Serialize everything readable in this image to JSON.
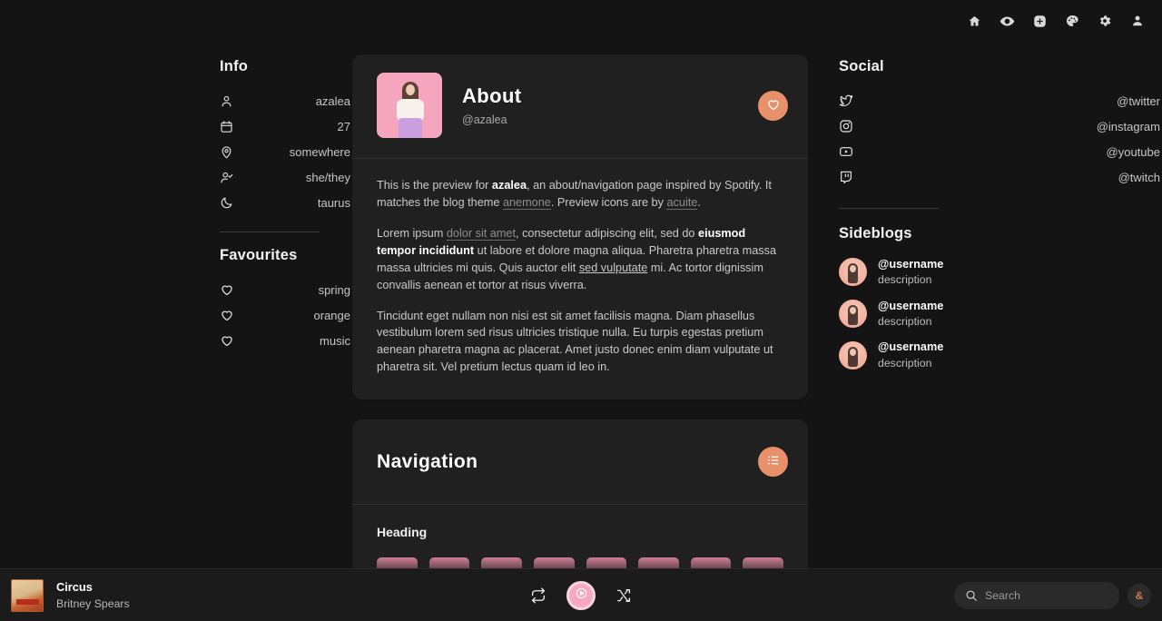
{
  "topbar": {
    "icons": [
      {
        "name": "home-icon",
        "label": "Home"
      },
      {
        "name": "eye-icon",
        "label": "Preview"
      },
      {
        "name": "plus-circle-icon",
        "label": "Add"
      },
      {
        "name": "palette-icon",
        "label": "Theme"
      },
      {
        "name": "gear-icon",
        "label": "Settings"
      },
      {
        "name": "person-icon",
        "label": "Account"
      }
    ]
  },
  "info": {
    "title": "Info",
    "rows": [
      {
        "icon": "person-icon",
        "value": "azalea"
      },
      {
        "icon": "calendar-icon",
        "value": "27"
      },
      {
        "icon": "location-pin-icon",
        "value": "somewhere"
      },
      {
        "icon": "person-check-icon",
        "value": "she/they"
      },
      {
        "icon": "moon-icon",
        "value": "taurus"
      }
    ]
  },
  "favourites": {
    "title": "Favourites",
    "rows": [
      {
        "icon": "heart-icon",
        "value": "spring"
      },
      {
        "icon": "heart-icon",
        "value": "orange"
      },
      {
        "icon": "heart-icon",
        "value": "music"
      }
    ]
  },
  "about_card": {
    "title": "About",
    "handle": "@azalea",
    "like_button": "heart-icon",
    "avatar_alt": "profile photo",
    "paragraphs": {
      "p1": {
        "a": "This is the preview for ",
        "bold1": "azalea",
        "b": ", an about/navigation page inspired by Spotify. It matches the blog theme ",
        "link1": "anemone",
        "c": ". Preview icons are by ",
        "link2": "acuite",
        "d": "."
      },
      "p2": {
        "a": "Lorem ipsum ",
        "link1": "dolor sit amet",
        "b": ", consectetur adipiscing elit, sed do ",
        "bold1": "eiusmod tempor incididunt",
        "c": " ut labore et dolore magna aliqua. Pharetra pharetra massa massa ultricies mi quis. Quis auctor elit ",
        "link2": "sed vulputate",
        "d": " mi. Ac tortor dignissim convallis aenean et tortor at risus viverra."
      },
      "p3": "Tincidunt eget nullam non nisi est sit amet facilisis magna. Diam phasellus vestibulum lorem sed risus ultricies tristique nulla. Eu turpis egestas pretium aenean pharetra magna ac placerat. Amet justo donec enim diam vulputate ut pharetra sit. Vel pretium lectus quam id leo in."
    }
  },
  "navigation_card": {
    "title": "Navigation",
    "menu_button": "list-icon",
    "heading": "Heading",
    "chips": [
      "",
      "",
      "",
      "",
      "",
      "",
      "",
      ""
    ]
  },
  "social": {
    "title": "Social",
    "rows": [
      {
        "icon": "twitter-icon",
        "value": "@twitter"
      },
      {
        "icon": "instagram-icon",
        "value": "@instagram"
      },
      {
        "icon": "youtube-icon",
        "value": "@youtube"
      },
      {
        "icon": "twitch-icon",
        "value": "@twitch"
      }
    ]
  },
  "sideblogs": {
    "title": "Sideblogs",
    "rows": [
      {
        "name": "@username",
        "description": "description"
      },
      {
        "name": "@username",
        "description": "description"
      },
      {
        "name": "@username",
        "description": "description"
      }
    ]
  },
  "player": {
    "track_title": "Circus",
    "artist": "Britney Spears",
    "repeat_icon": "repeat-icon",
    "play_icon": "play-icon",
    "shuffle_icon": "shuffle-icon",
    "search_placeholder": "Search",
    "search_value": "",
    "credit_label": "&"
  },
  "colors": {
    "page_bg": "#141414",
    "card_bg": "#202020",
    "accent_orange": "#e8906a",
    "accent_pink": "#f5a9c0",
    "chip_rose": "#cf7f95",
    "text_primary": "#ffffff",
    "text_muted": "#c6c6c6"
  }
}
